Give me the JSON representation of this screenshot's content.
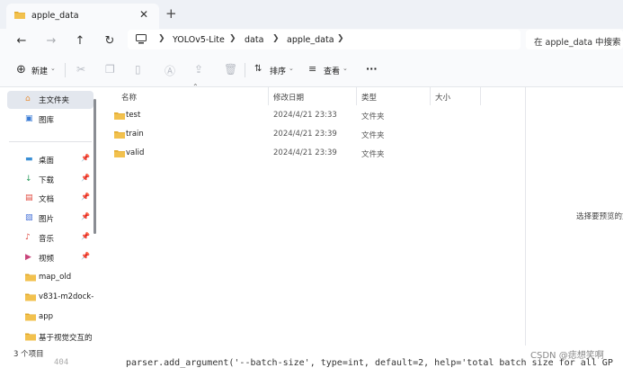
{
  "tab": {
    "title": "apple_data",
    "close_icon": "✕",
    "new_icon": "+"
  },
  "nav": {
    "back_icon": "←",
    "forward_icon": "→",
    "up_icon": "↑",
    "refresh_icon": "↻",
    "breadcrumbs": [
      "YOLOv5-Lite",
      "data",
      "apple_data"
    ],
    "search_placeholder": "在 apple_data 中搜索"
  },
  "toolbar": {
    "new_label": "新建",
    "sort_label": "排序",
    "view_label": "查看",
    "more_label": "···"
  },
  "sidebar": {
    "items": [
      {
        "label": "主文件夹",
        "icon": "home-icon"
      },
      {
        "label": "图库",
        "icon": "gallery-icon"
      },
      {
        "label": "桌面",
        "icon": "desktop-icon",
        "pinned": true
      },
      {
        "label": "下载",
        "icon": "download-icon",
        "pinned": true
      },
      {
        "label": "文档",
        "icon": "document-icon",
        "pinned": true
      },
      {
        "label": "图片",
        "icon": "picture-icon",
        "pinned": true
      },
      {
        "label": "音乐",
        "icon": "music-icon",
        "pinned": true
      },
      {
        "label": "视频",
        "icon": "video-icon",
        "pinned": true
      },
      {
        "label": "map_old",
        "icon": "folder-icon"
      },
      {
        "label": "v831-m2dock-",
        "icon": "folder-icon"
      },
      {
        "label": "app",
        "icon": "folder-icon"
      },
      {
        "label": "基于视觉交互的",
        "icon": "folder-icon"
      }
    ]
  },
  "columns": {
    "name": "名称",
    "date": "修改日期",
    "type": "类型",
    "size": "大小"
  },
  "files": [
    {
      "name": "test",
      "date": "2024/4/21 23:33",
      "type": "文件夹"
    },
    {
      "name": "train",
      "date": "2024/4/21 23:39",
      "type": "文件夹"
    },
    {
      "name": "valid",
      "date": "2024/4/21 23:39",
      "type": "文件夹"
    }
  ],
  "preview": {
    "text": "选择要预览的文"
  },
  "status": {
    "count": "3 个项目"
  },
  "background_code": {
    "line": "404",
    "text": "parser.add_argument('--batch-size', type=int, default=2, help='total batch size for all GP"
  },
  "watermark": "CSDN @痣想笑啊",
  "colors": {
    "folder": "#f2c14e",
    "folder_dark": "#e0a82a",
    "selected": "#e3e7ee"
  }
}
